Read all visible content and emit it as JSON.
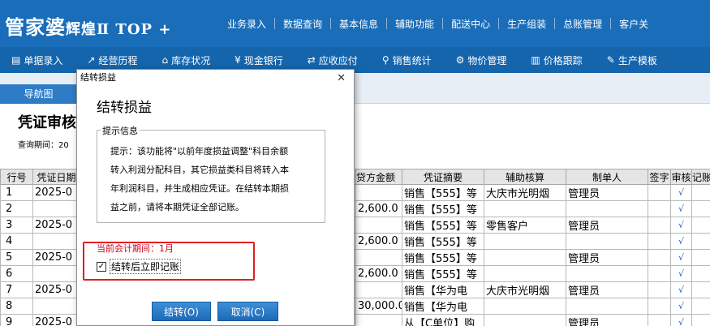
{
  "header": {
    "logo_main": "管家婆",
    "logo_sub": "辉煌",
    "logo_edition": "Ⅱ TOP +",
    "nav": [
      "业务录入",
      "数据查询",
      "基本信息",
      "辅助功能",
      "配送中心",
      "生产组装",
      "总账管理",
      "客户关"
    ]
  },
  "toolbar": {
    "items": [
      {
        "icon": "document-icon",
        "glyph": "▤",
        "label": "单据录入"
      },
      {
        "icon": "chart-icon",
        "glyph": "↗",
        "label": "经营历程"
      },
      {
        "icon": "home-icon",
        "glyph": "⌂",
        "label": "库存状况"
      },
      {
        "icon": "yen-icon",
        "glyph": "¥",
        "label": "现金银行"
      },
      {
        "icon": "exchange-icon",
        "glyph": "⇄",
        "label": "应收应付"
      },
      {
        "icon": "search-icon",
        "glyph": "⚲",
        "label": "销售统计"
      },
      {
        "icon": "gear-icon",
        "glyph": "⚙",
        "label": "物价管理"
      },
      {
        "icon": "bar-chart-icon",
        "glyph": "▥",
        "label": "价格跟踪"
      },
      {
        "icon": "wrench-icon",
        "glyph": "✎",
        "label": "生产模板"
      }
    ]
  },
  "tabs": {
    "active": "导航图"
  },
  "page": {
    "title": "凭证审核",
    "query_label": "查询期间：20"
  },
  "table": {
    "headers": [
      "行号",
      "凭证日期",
      "",
      "",
      "",
      "贷方金额",
      "凭证摘要",
      "辅助核算",
      "制单人",
      "签字",
      "审核",
      "记账"
    ],
    "rows": [
      {
        "no": "1",
        "date": "2025-0",
        "credit": "",
        "summary": "销售【555】等",
        "aux": "大庆市光明烟",
        "maker": "管理员",
        "audit": "√"
      },
      {
        "no": "2",
        "date": "",
        "credit": "2,600.0",
        "summary": "销售【555】等",
        "aux": "",
        "maker": "",
        "audit": "√"
      },
      {
        "no": "3",
        "date": "2025-0",
        "credit": "",
        "summary": "销售【555】等",
        "aux": "零售客户",
        "maker": "管理员",
        "audit": "√"
      },
      {
        "no": "4",
        "date": "",
        "credit": "2,600.0",
        "summary": "销售【555】等",
        "aux": "",
        "maker": "",
        "audit": "√"
      },
      {
        "no": "5",
        "date": "2025-0",
        "credit": "",
        "summary": "销售【555】等",
        "aux": "",
        "maker": "管理员",
        "audit": "√"
      },
      {
        "no": "6",
        "date": "",
        "credit": "2,600.0",
        "summary": "销售【555】等",
        "aux": "",
        "maker": "",
        "audit": "√"
      },
      {
        "no": "7",
        "date": "2025-0",
        "credit": "",
        "summary": "销售【华为电",
        "aux": "大庆市光明烟",
        "maker": "管理员",
        "audit": "√"
      },
      {
        "no": "8",
        "date": "",
        "credit": "30,000.0",
        "summary": "销售【华为电",
        "aux": "",
        "maker": "",
        "audit": "√"
      },
      {
        "no": "9",
        "date": "2025-0",
        "credit": "",
        "summary": "从【C单位】购",
        "aux": "",
        "maker": "管理员",
        "audit": "√"
      }
    ]
  },
  "dialog": {
    "title": "结转损益",
    "heading": "结转损益",
    "group_label": "提示信息",
    "lines": [
      "提示：该功能将\"以前年度损益调整\"科目余额",
      "转入利润分配科目，其它损益类科目将转入本",
      "年利润科目，并生成相应凭证。在结转本期损",
      "益之前，请将本期凭证全部记账。"
    ],
    "period": "当前会计期间：1月",
    "checkbox_label": "结转后立即记账",
    "checkbox_checked": true,
    "ok_label": "结转(O)",
    "cancel_label": "取消(C)"
  },
  "colors": {
    "header_bg": "#1a6db8",
    "toolbar_bg": "#1565ad",
    "highlight_red": "#e02020"
  }
}
